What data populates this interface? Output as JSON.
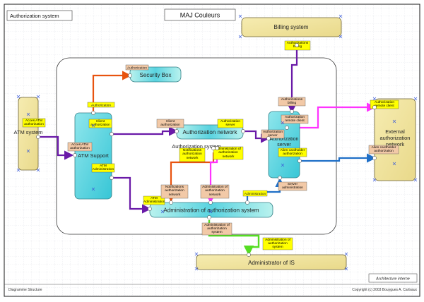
{
  "header": {
    "frame_title": "Authorization system",
    "center_title": "MAJ Couleurs"
  },
  "footer": {
    "left": "Diagramme Structure",
    "right": "Copyright (c) 2003 Bouygues A. Carlsaux",
    "legend": "Architecture interne"
  },
  "components": {
    "billing": "Billing system",
    "atm_system": "ATM system",
    "external": "External authorization network",
    "admin_is": "Administrator of IS",
    "security_box": "Security Box",
    "atm_support": "ATM Support",
    "auth_network": "Authorization network",
    "auth_system": "Authorization system",
    "authorization_server": "Authorization server",
    "admin_auth": "Administration of authorization system"
  },
  "ports": {
    "auth_billing": "Authorizations billing",
    "authorization_sb": "Authorization",
    "authorization_atm": "Authorization",
    "client_auth_atm": "Client authorization",
    "acces_atm_auth": "Acces ATM authorization",
    "acces_atm_auth_sys": "Acces ATM authorization",
    "atm_admin": "ATM Administration",
    "atm_admin_2": "ATM Administration",
    "client_auth_net": "Client authorization",
    "auth_server_net": "Authorization server",
    "notif_auth_net": "Notifications authorization network",
    "admin_auth_net": "Administration of authorization network",
    "auth_billing_srv": "Authorizations billing",
    "auth_remote_client": "Authorization remote client",
    "auth_server_srv": "Authorization server",
    "alien_cardholder": "Alien cardholder authorization",
    "auth_remote_ext": "Authorization remote client",
    "alien_cardholder_ext": "Alien cardholder authorization",
    "notif_auth_adm": "Notifications authorization network",
    "admin_auth_net_adm": "Administration of authorization network",
    "administration_adm": "Administration",
    "server_admin": "Server administration",
    "admin_auth_sys": "Administration of authorization system",
    "admin_auth_sys_is": "Administration of authorization system",
    "administration_srv": "Administration"
  },
  "colors": {
    "component_fill": "#f2e49a",
    "port_yellow": "#ffff00",
    "port_tan": "#f2c9a7",
    "connector_orange": "#e8530f",
    "connector_purple": "#6a1aa8",
    "connector_magenta": "#ff33ff",
    "connector_blue": "#1f6fc7",
    "connector_green": "#55dd22",
    "grid": "#d7d9e2"
  }
}
